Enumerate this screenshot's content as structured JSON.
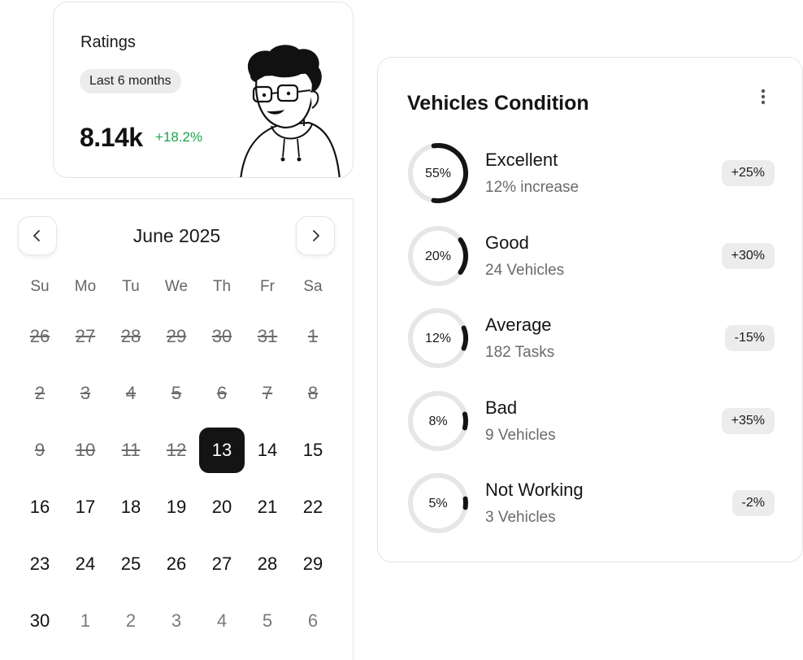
{
  "ratings": {
    "title": "Ratings",
    "period": "Last 6 months",
    "value": "8.14k",
    "change": "+18.2%",
    "change_color": "#1aa24a"
  },
  "calendar": {
    "month_label": "June 2025",
    "prev_icon": "chevron-left-icon",
    "next_icon": "chevron-right-icon",
    "weekdays": [
      "Su",
      "Mo",
      "Tu",
      "We",
      "Th",
      "Fr",
      "Sa"
    ],
    "weeks": [
      [
        {
          "d": "26",
          "s": "past"
        },
        {
          "d": "27",
          "s": "past"
        },
        {
          "d": "28",
          "s": "past"
        },
        {
          "d": "29",
          "s": "past"
        },
        {
          "d": "30",
          "s": "past"
        },
        {
          "d": "31",
          "s": "past"
        },
        {
          "d": "1",
          "s": "past"
        }
      ],
      [
        {
          "d": "2",
          "s": "past"
        },
        {
          "d": "3",
          "s": "past"
        },
        {
          "d": "4",
          "s": "past"
        },
        {
          "d": "5",
          "s": "past"
        },
        {
          "d": "6",
          "s": "past"
        },
        {
          "d": "7",
          "s": "past"
        },
        {
          "d": "8",
          "s": "past"
        }
      ],
      [
        {
          "d": "9",
          "s": "past"
        },
        {
          "d": "10",
          "s": "past"
        },
        {
          "d": "11",
          "s": "past"
        },
        {
          "d": "12",
          "s": "past"
        },
        {
          "d": "13",
          "s": "selected"
        },
        {
          "d": "14",
          "s": "current"
        },
        {
          "d": "15",
          "s": "current"
        }
      ],
      [
        {
          "d": "16",
          "s": "current"
        },
        {
          "d": "17",
          "s": "current"
        },
        {
          "d": "18",
          "s": "current"
        },
        {
          "d": "19",
          "s": "current"
        },
        {
          "d": "20",
          "s": "current"
        },
        {
          "d": "21",
          "s": "current"
        },
        {
          "d": "22",
          "s": "current"
        }
      ],
      [
        {
          "d": "23",
          "s": "current"
        },
        {
          "d": "24",
          "s": "current"
        },
        {
          "d": "25",
          "s": "current"
        },
        {
          "d": "26",
          "s": "current"
        },
        {
          "d": "27",
          "s": "current"
        },
        {
          "d": "28",
          "s": "current"
        },
        {
          "d": "29",
          "s": "current"
        }
      ],
      [
        {
          "d": "30",
          "s": "current"
        },
        {
          "d": "1",
          "s": "next-month"
        },
        {
          "d": "2",
          "s": "next-month"
        },
        {
          "d": "3",
          "s": "next-month"
        },
        {
          "d": "4",
          "s": "next-month"
        },
        {
          "d": "5",
          "s": "next-month"
        },
        {
          "d": "6",
          "s": "next-month"
        }
      ]
    ]
  },
  "vehicles": {
    "title": "Vehicles Condition",
    "menu_icon": "more-vertical-icon",
    "ring_color": "#151515",
    "track_color": "#e6e6e6",
    "items": [
      {
        "label": "55%",
        "percent": 55,
        "name": "Excellent",
        "sub": "12% increase",
        "badge": "+25%"
      },
      {
        "label": "20%",
        "percent": 20,
        "name": "Good",
        "sub": "24 Vehicles",
        "badge": "+30%"
      },
      {
        "label": "12%",
        "percent": 12,
        "name": "Average",
        "sub": "182 Tasks",
        "badge": "-15%"
      },
      {
        "label": "8%",
        "percent": 8,
        "name": "Bad",
        "sub": "9 Vehicles",
        "badge": "+35%"
      },
      {
        "label": "5%",
        "percent": 5,
        "name": "Not Working",
        "sub": "3 Vehicles",
        "badge": "-2%"
      }
    ]
  }
}
